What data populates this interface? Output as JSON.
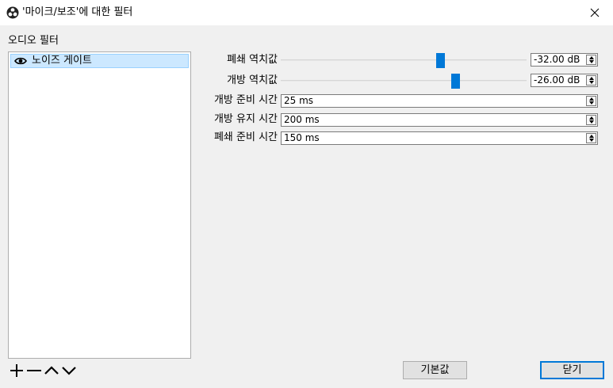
{
  "window": {
    "title": "'마이크/보조'에 대한 필터",
    "app_icon": "obs-logo-icon",
    "close_icon": "close-icon"
  },
  "filters": {
    "section_label": "오디오 필터",
    "items": [
      {
        "label": "노이즈 게이트",
        "visible_icon": "eye-icon",
        "selected": true
      }
    ],
    "controls": {
      "add": "plus-icon",
      "remove": "minus-icon",
      "move_up": "chevron-up-icon",
      "move_down": "chevron-down-icon"
    }
  },
  "properties": {
    "close_threshold": {
      "label": "폐쇄 역치값",
      "value": "-32.00 dB",
      "slider_fraction": 0.655
    },
    "open_threshold": {
      "label": "개방 역치값",
      "value": "-26.00 dB",
      "slider_fraction": 0.72
    },
    "attack_time": {
      "label": "개방 준비 시간",
      "value": "25 ms"
    },
    "hold_time": {
      "label": "개방 유지 시간",
      "value": "200 ms"
    },
    "release_time": {
      "label": "폐쇄 준비 시간",
      "value": "150 ms"
    }
  },
  "footer": {
    "defaults_label": "기본값",
    "close_label": "닫기"
  },
  "colors": {
    "accent": "#0078d7",
    "selection": "#cce8ff"
  }
}
